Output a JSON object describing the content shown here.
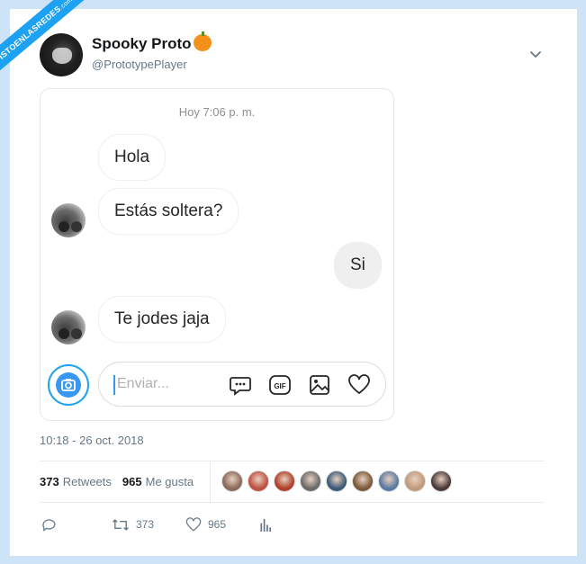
{
  "watermark": {
    "main": "VISTOENLASREDES",
    "suffix": ".com"
  },
  "tweet": {
    "display_name": "Spooky Proto",
    "handle": "@PrototypePlayer",
    "timestamp": "10:18 - 26 oct. 2018",
    "stats": {
      "retweets_count": "373",
      "retweets_label": "Retweets",
      "likes_count": "965",
      "likes_label": "Me gusta"
    },
    "actions": {
      "retweets": "373",
      "likes": "965"
    },
    "liker_colors": [
      "#8a6a5a",
      "#c05040",
      "#b0402a",
      "#6a6a6a",
      "#3c5a7a",
      "#7a5a3a",
      "#5a7aa0",
      "#c09a7a",
      "#4a3a3a"
    ]
  },
  "chat": {
    "time_header": "Hoy 7:06 p. m.",
    "messages": [
      {
        "text": "Hola",
        "from": "other"
      },
      {
        "text": "Estás soltera?",
        "from": "other"
      },
      {
        "text": "Si",
        "from": "me"
      },
      {
        "text": "Te jodes jaja",
        "from": "other"
      }
    ],
    "composer": {
      "placeholder": "Enviar..."
    }
  },
  "colors": {
    "accent": "#1da1f2",
    "camera": "#3897f0",
    "background": "#cfe3f6"
  }
}
